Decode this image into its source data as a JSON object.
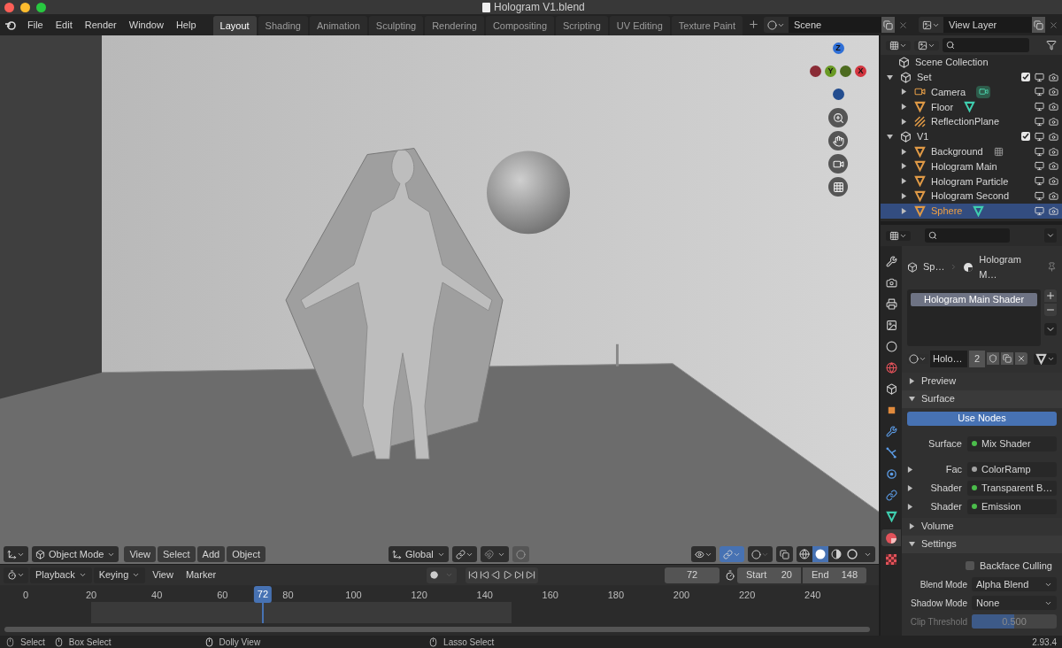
{
  "window": {
    "title": "Hologram V1.blend"
  },
  "menu": [
    "File",
    "Edit",
    "Render",
    "Window",
    "Help"
  ],
  "workspaces": [
    {
      "label": "Layout",
      "selected": true
    },
    {
      "label": "Shading",
      "selected": false
    },
    {
      "label": "Animation",
      "selected": false
    },
    {
      "label": "Sculpting",
      "selected": false
    },
    {
      "label": "Rendering",
      "selected": false
    },
    {
      "label": "Compositing",
      "selected": false
    },
    {
      "label": "Scripting",
      "selected": false
    },
    {
      "label": "UV Editing",
      "selected": false
    },
    {
      "label": "Texture Paint",
      "selected": false
    }
  ],
  "scene": {
    "value": "Scene"
  },
  "view_layer": {
    "value": "View Layer"
  },
  "viewport": {
    "gizmo": [
      {
        "label": "Z",
        "color": "#2f6fd6"
      },
      {
        "label": "Y",
        "color": "#6a9a24"
      },
      {
        "label": "X",
        "color": "#d2353f"
      }
    ],
    "header": {
      "mode": "Object Mode",
      "menus": [
        "View",
        "Select",
        "Add",
        "Object"
      ],
      "orientation": "Global",
      "gizmos_on": true,
      "shading": [
        {
          "kind": "wireframe",
          "selected": false
        },
        {
          "kind": "solid",
          "selected": true
        },
        {
          "kind": "material",
          "selected": false
        },
        {
          "kind": "rendered",
          "selected": false
        }
      ]
    }
  },
  "timeline": {
    "menus": [
      "Playback",
      "Keying",
      "View",
      "Marker"
    ],
    "current_frame": "72",
    "start_label": "Start",
    "start": "20",
    "end_label": "End",
    "end": "148",
    "ticks": [
      "0",
      "20",
      "40",
      "60",
      "80",
      "100",
      "120",
      "140",
      "160",
      "180",
      "200",
      "220",
      "240"
    ],
    "playhead": {
      "label": "72",
      "level": 0.299
    }
  },
  "outliner": {
    "root": "Scene Collection",
    "items": [
      {
        "name": "Set",
        "kind": "collection",
        "expanded": true,
        "checked": true,
        "selected": false,
        "children": [
          {
            "name": "Camera",
            "kind": "camera",
            "expanded": false,
            "badge": {
              "kind": "camera"
            },
            "selected": false
          },
          {
            "name": "Floor",
            "kind": "mesh",
            "expanded": false,
            "badge": {
              "kind": "mesh"
            },
            "selected": false
          },
          {
            "name": "ReflectionPlane",
            "kind": "probe",
            "expanded": false,
            "selected": false
          }
        ]
      },
      {
        "name": "V1",
        "kind": "collection",
        "expanded": true,
        "checked": true,
        "selected": false,
        "children": [
          {
            "name": "Background",
            "kind": "mesh",
            "expanded": false,
            "badge": {
              "kind": "modifier"
            },
            "selected": false
          },
          {
            "name": "Hologram Main",
            "kind": "mesh",
            "expanded": false,
            "selected": false
          },
          {
            "name": "Hologram Particle",
            "kind": "mesh",
            "expanded": false,
            "selected": false
          },
          {
            "name": "Hologram Second",
            "kind": "mesh",
            "expanded": false,
            "selected": false
          },
          {
            "name": "Sphere",
            "kind": "mesh",
            "expanded": false,
            "badge": {
              "kind": "mesh"
            },
            "selected": true
          }
        ]
      }
    ]
  },
  "properties": {
    "tabs": [
      {
        "kind": "tool",
        "selected": false
      },
      {
        "kind": "render",
        "selected": false
      },
      {
        "kind": "output",
        "selected": false
      },
      {
        "kind": "view_layer",
        "selected": false
      },
      {
        "kind": "scene",
        "selected": false
      },
      {
        "kind": "world",
        "selected": false
      },
      {
        "kind": "collection",
        "selected": false
      },
      {
        "kind": "object",
        "selected": false
      },
      {
        "kind": "modifiers",
        "selected": false
      },
      {
        "kind": "particles",
        "selected": false
      },
      {
        "kind": "physics",
        "selected": false
      },
      {
        "kind": "constraints",
        "selected": false
      },
      {
        "kind": "data",
        "selected": false
      },
      {
        "kind": "material",
        "selected": true
      },
      {
        "kind": "texture",
        "selected": false
      }
    ],
    "breadcrumb": [
      "Sp…",
      "Hologram M…"
    ],
    "slots": [
      {
        "name": "Hologram Main Shader",
        "selected": true
      }
    ],
    "material": {
      "name": "Holo…",
      "users": "2"
    },
    "panels": [
      {
        "title": "Preview",
        "expanded": false
      },
      {
        "title": "Surface",
        "expanded": true,
        "use_nodes": {
          "label": "Use Nodes",
          "on": true
        },
        "rows": [
          {
            "label": "Surface",
            "value": "Mix Shader",
            "color": "#4bbd4b",
            "expandable": false
          },
          {
            "label": "Fac",
            "value": "ColorRamp",
            "color": "#a3a3a3",
            "expandable": true
          },
          {
            "label": "Shader",
            "value": "Transparent B…",
            "color": "#4bbd4b",
            "expandable": true
          },
          {
            "label": "Shader",
            "value": "Emission",
            "color": "#4bbd4b",
            "expandable": true
          }
        ]
      },
      {
        "title": "Volume",
        "expanded": false
      },
      {
        "title": "Settings",
        "expanded": true,
        "backface": {
          "label": "Backface Culling",
          "checked": false
        },
        "selects": [
          {
            "label": "Blend Mode",
            "value": "Alpha Blend"
          },
          {
            "label": "Shadow Mode",
            "value": "None"
          }
        ],
        "clip": {
          "label": "Clip Threshold",
          "value": "0.500",
          "level": 0.5,
          "disabled": true
        }
      }
    ]
  },
  "status_bar": {
    "hints": [
      {
        "kind": "left",
        "label": "Select"
      },
      {
        "kind": "both",
        "label": "Box Select"
      },
      {
        "kind": "middle",
        "label": "Dolly View"
      },
      {
        "kind": "both",
        "label": "Lasso Select"
      }
    ],
    "version": "2.93.4"
  }
}
